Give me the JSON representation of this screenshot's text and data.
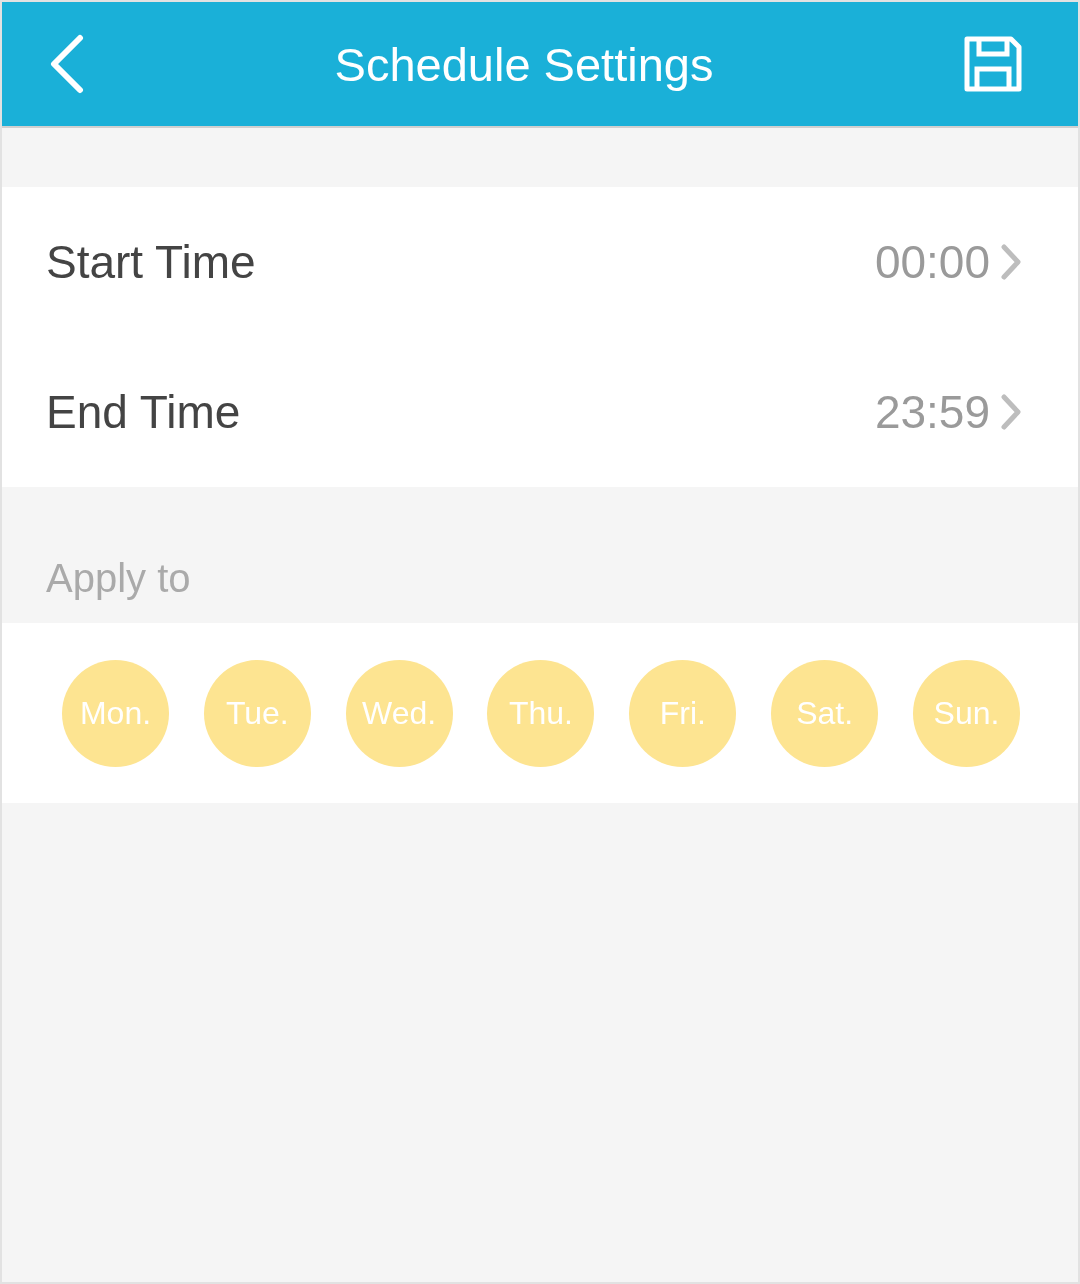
{
  "header": {
    "title": "Schedule Settings"
  },
  "time_rows": [
    {
      "label": "Start Time",
      "value": "00:00"
    },
    {
      "label": "End Time",
      "value": "23:59"
    }
  ],
  "apply_to": {
    "label": "Apply to",
    "days": [
      {
        "label": "Mon.",
        "selected": true
      },
      {
        "label": "Tue.",
        "selected": true
      },
      {
        "label": "Wed.",
        "selected": true
      },
      {
        "label": "Thu.",
        "selected": true
      },
      {
        "label": "Fri.",
        "selected": true
      },
      {
        "label": "Sat.",
        "selected": true
      },
      {
        "label": "Sun.",
        "selected": true
      }
    ]
  }
}
